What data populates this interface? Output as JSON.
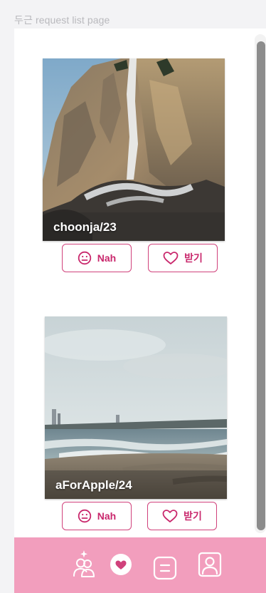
{
  "page": {
    "label": "두근 request list page"
  },
  "cards": [
    {
      "caption": "choonja/23",
      "nah_label": "Nah",
      "accept_label": "받기"
    },
    {
      "caption": "aForApple/24",
      "nah_label": "Nah",
      "accept_label": "받기"
    }
  ],
  "tabbar": {
    "items": [
      {
        "icon": "person-sparkle-icon"
      },
      {
        "icon": "heart-bubble-icon"
      },
      {
        "icon": "chat-list-icon"
      },
      {
        "icon": "profile-icon"
      }
    ]
  },
  "colors": {
    "accent": "#c9276c",
    "tabbar": "#f29ebd",
    "label_gray": "#b9b9bd"
  }
}
